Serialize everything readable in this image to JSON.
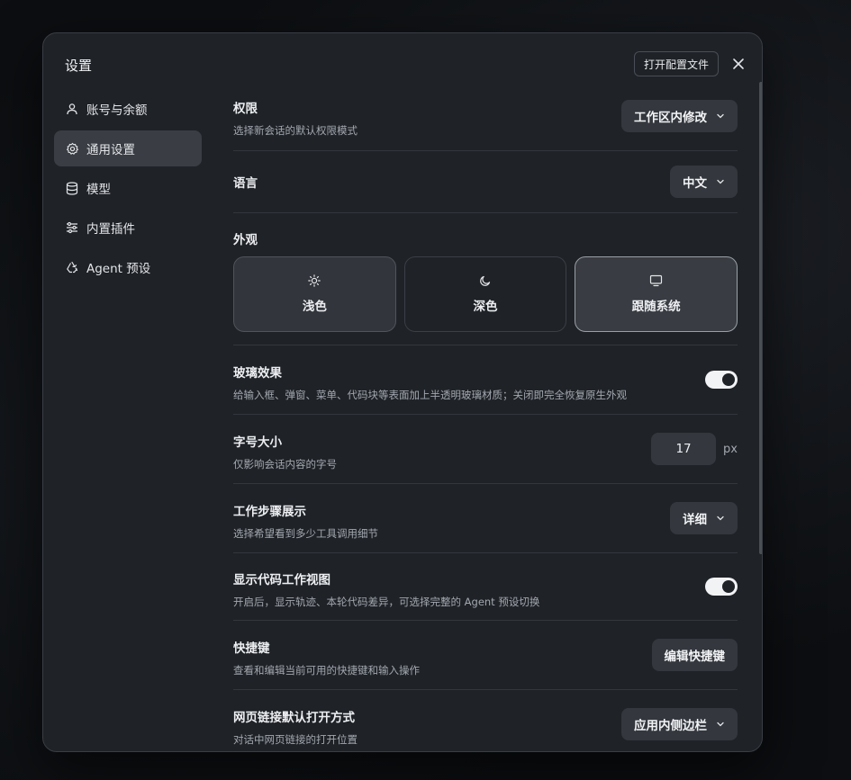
{
  "dialog": {
    "title": "设置",
    "open_config_label": "打开配置文件"
  },
  "sidebar": {
    "items": [
      {
        "label": "账号与余额",
        "icon": "user-icon"
      },
      {
        "label": "通用设置",
        "icon": "gear-icon",
        "active": true
      },
      {
        "label": "模型",
        "icon": "database-icon"
      },
      {
        "label": "内置插件",
        "icon": "sliders-icon"
      },
      {
        "label": "Agent 预设",
        "icon": "recycle-icon"
      }
    ]
  },
  "settings": {
    "permissions": {
      "label": "权限",
      "desc": "选择新会话的默认权限模式",
      "value": "工作区内修改"
    },
    "language": {
      "label": "语言",
      "value": "中文"
    },
    "appearance": {
      "label": "外观",
      "options": [
        {
          "label": "浅色",
          "icon": "sun-icon"
        },
        {
          "label": "深色",
          "icon": "moon-icon"
        },
        {
          "label": "跟随系统",
          "icon": "monitor-icon",
          "selected": true
        }
      ]
    },
    "glass": {
      "label": "玻璃效果",
      "desc": "给输入框、弹窗、菜单、代码块等表面加上半透明玻璃材质；关闭即完全恢复原生外观",
      "enabled": true
    },
    "font_size": {
      "label": "字号大小",
      "desc": "仅影响会话内容的字号",
      "value": "17",
      "unit": "px"
    },
    "work_steps": {
      "label": "工作步骤展示",
      "desc": "选择希望看到多少工具调用细节",
      "value": "详细"
    },
    "code_view": {
      "label": "显示代码工作视图",
      "desc": "开启后，显示轨迹、本轮代码差异，可选择完整的 Agent 预设切换",
      "enabled": true
    },
    "shortcuts": {
      "label": "快捷键",
      "desc": "查看和编辑当前可用的快捷键和输入操作",
      "button": "编辑快捷键"
    },
    "link_open": {
      "label": "网页链接默认打开方式",
      "desc": "对话中网页链接的打开位置",
      "value": "应用内侧边栏"
    }
  }
}
